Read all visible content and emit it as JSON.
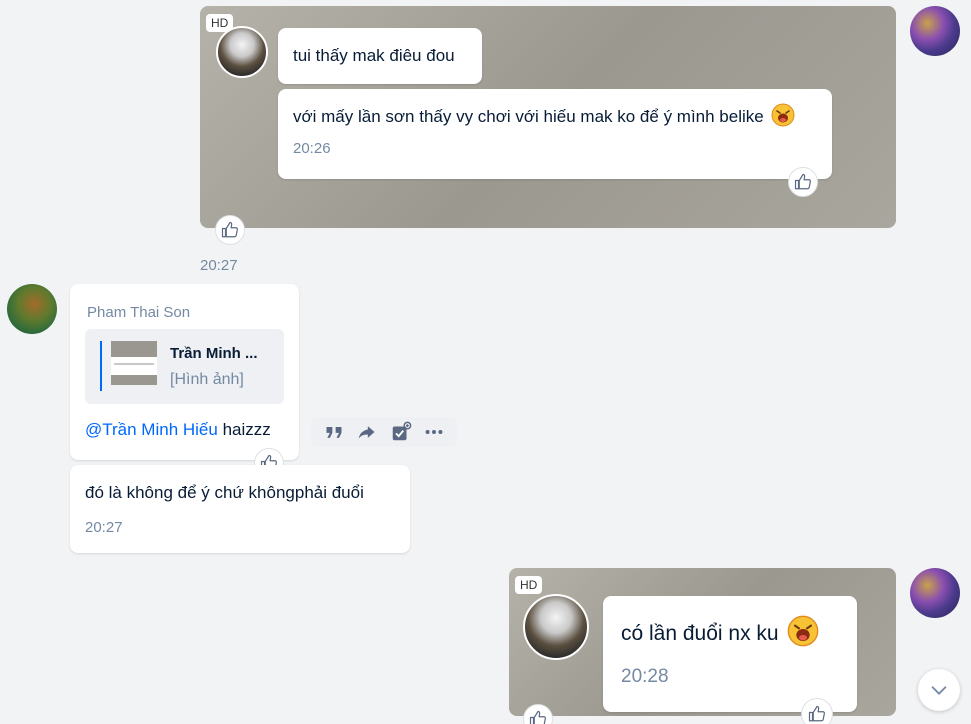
{
  "messages": {
    "m1": {
      "badge": "HD",
      "line1": "tui thấy mak điêu đou",
      "line2": "với mấy lần sơn thấy vy chơi với hiếu mak ko để ý mình belike",
      "inner_time": "20:26",
      "outer_time": "20:27"
    },
    "m2": {
      "sender": "Pham Thai Son",
      "quote_name": "Trần Minh ...",
      "quote_type": "[Hình ảnh]",
      "mention": "@Trần Minh Hiếu",
      "text": " haizzz"
    },
    "m3": {
      "text": "đó là không để ý chứ khôngphải đuổi",
      "time": "20:27"
    },
    "m4": {
      "badge": "HD",
      "text": "có lần đuổi nx ku",
      "time": "20:28"
    }
  },
  "icons": [
    "like-icon",
    "quote-icon",
    "forward-icon",
    "todo-icon",
    "more-icon",
    "chevron-down-icon",
    "laughing-emoji-icon"
  ],
  "colors": {
    "accent": "#0068ff",
    "timestamp": "#7589a3",
    "background": "#f2f3f5"
  }
}
